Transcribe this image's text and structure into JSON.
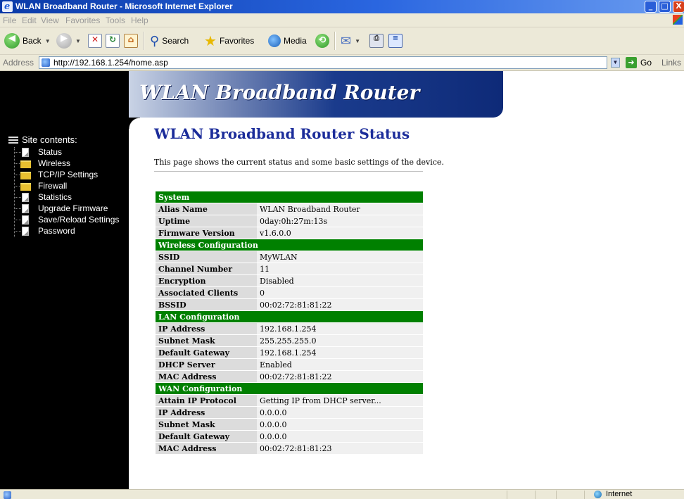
{
  "window": {
    "title": "WLAN Broadband Router - Microsoft Internet Explorer",
    "controls": {
      "minimize": "_",
      "maximize": "□",
      "close": "X"
    }
  },
  "menu": [
    "File",
    "Edit",
    "View",
    "Favorites",
    "Tools",
    "Help"
  ],
  "toolbar": {
    "back": "Back",
    "search": "Search",
    "favorites": "Favorites",
    "media": "Media"
  },
  "address": {
    "label": "Address",
    "url": "http://192.168.1.254/home.asp",
    "go": "Go",
    "links": "Links"
  },
  "banner": {
    "title": "WLAN Broadband Router"
  },
  "sidebar": {
    "heading": "Site contents:",
    "items": [
      {
        "label": "Status",
        "icon": "document-icon"
      },
      {
        "label": "Wireless",
        "icon": "folder-icon"
      },
      {
        "label": "TCP/IP Settings",
        "icon": "folder-icon"
      },
      {
        "label": "Firewall",
        "icon": "folder-icon"
      },
      {
        "label": "Statistics",
        "icon": "document-icon"
      },
      {
        "label": "Upgrade Firmware",
        "icon": "document-icon"
      },
      {
        "label": "Save/Reload Settings",
        "icon": "document-icon"
      },
      {
        "label": "Password",
        "icon": "document-icon"
      }
    ]
  },
  "page": {
    "title": "WLAN Broadband Router Status",
    "description": "This page shows the current status and some basic settings of the device."
  },
  "status": {
    "system": {
      "heading": "System",
      "rows": [
        {
          "label": "Alias Name",
          "value": "WLAN Broadband Router"
        },
        {
          "label": "Uptime",
          "value": "0day:0h:27m:13s"
        },
        {
          "label": "Firmware Version",
          "value": "v1.6.0.0"
        }
      ]
    },
    "wireless": {
      "heading": "Wireless Configuration",
      "rows": [
        {
          "label": "SSID",
          "value": "MyWLAN"
        },
        {
          "label": "Channel Number",
          "value": "11"
        },
        {
          "label": "Encryption",
          "value": "Disabled"
        },
        {
          "label": "Associated Clients",
          "value": "0"
        },
        {
          "label": "BSSID",
          "value": "00:02:72:81:81:22"
        }
      ]
    },
    "lan": {
      "heading": "LAN Configuration",
      "rows": [
        {
          "label": "IP Address",
          "value": "192.168.1.254"
        },
        {
          "label": "Subnet Mask",
          "value": "255.255.255.0"
        },
        {
          "label": "Default Gateway",
          "value": "192.168.1.254"
        },
        {
          "label": "DHCP Server",
          "value": "Enabled"
        },
        {
          "label": "MAC Address",
          "value": "00:02:72:81:81:22"
        }
      ]
    },
    "wan": {
      "heading": "WAN Configuration",
      "rows": [
        {
          "label": "Attain IP Protocol",
          "value": "Getting IP from DHCP server..."
        },
        {
          "label": "IP Address",
          "value": "0.0.0.0"
        },
        {
          "label": "Subnet Mask",
          "value": "0.0.0.0"
        },
        {
          "label": "Default Gateway",
          "value": "0.0.0.0"
        },
        {
          "label": "MAC Address",
          "value": "00:02:72:81:81:23"
        }
      ]
    }
  },
  "statusbar": {
    "zone": "Internet"
  },
  "colors": {
    "section_header": "#008000",
    "title_blue": "#1b2c9a",
    "sidebar_bg": "#000000"
  }
}
